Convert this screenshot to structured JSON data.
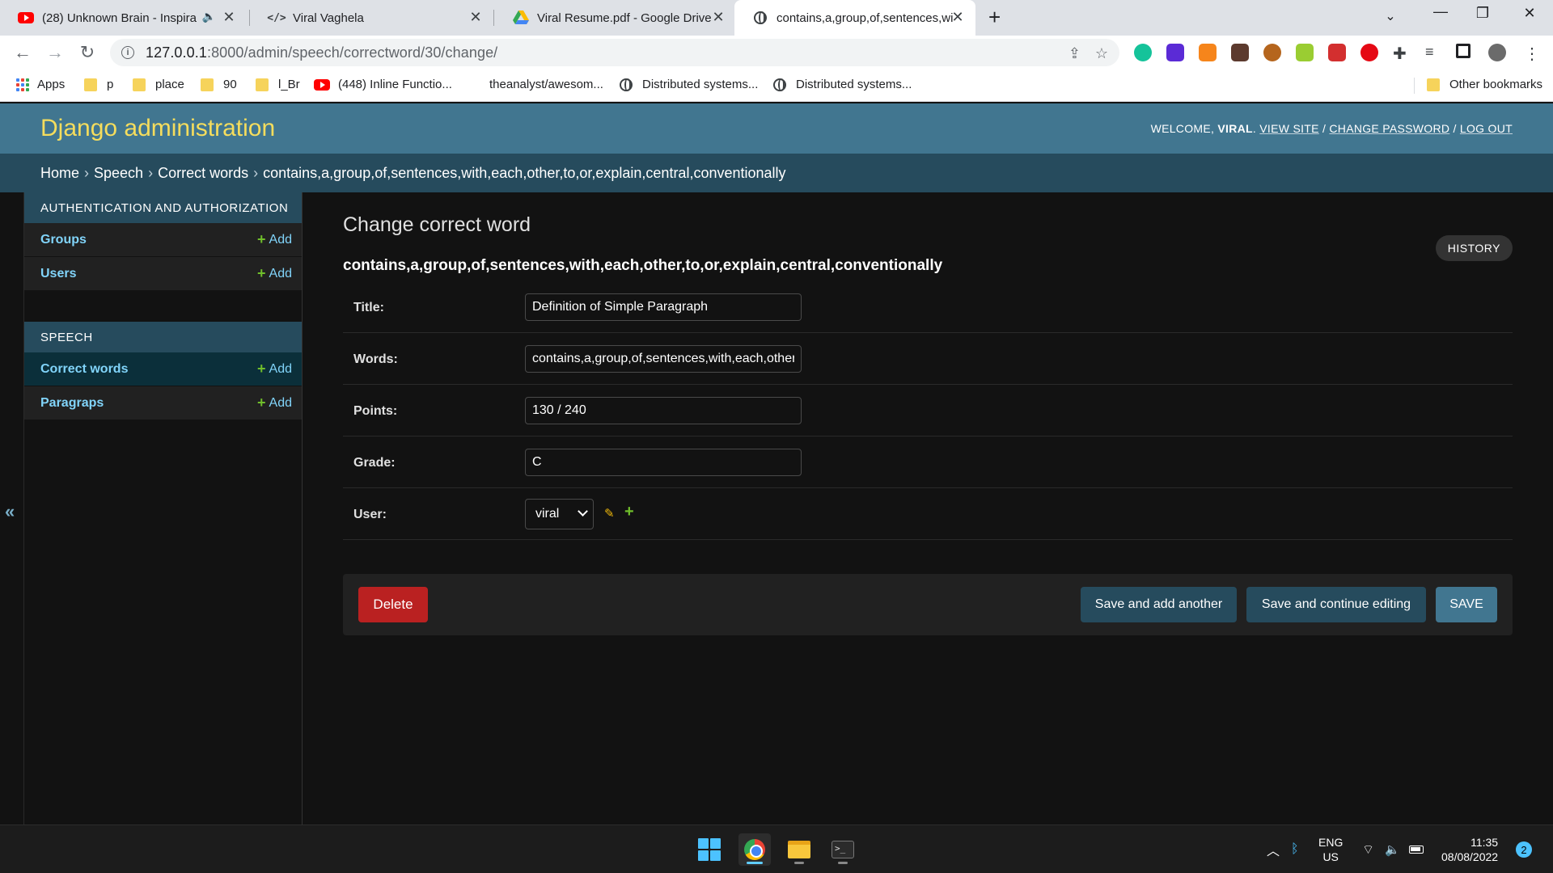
{
  "browser": {
    "tabs": [
      {
        "title": "(28) Unknown Brain - Inspira",
        "icon": "youtube-icon",
        "audio": "🔈"
      },
      {
        "title": "Viral Vaghela",
        "icon": "code-icon"
      },
      {
        "title": "Viral Resume.pdf - Google Drive",
        "icon": "google-drive-icon"
      },
      {
        "title": "contains,a,group,of,sentences,wi",
        "icon": "globe-icon",
        "active": true
      }
    ],
    "new_tab": "+",
    "url_host": "127.0.0.1",
    "url_path": ":8000/admin/speech/correctword/30/change/",
    "bookmarks": [
      {
        "label": "Apps",
        "icon": "apps-icon"
      },
      {
        "label": "p",
        "icon": "folder-icon"
      },
      {
        "label": "place",
        "icon": "folder-icon"
      },
      {
        "label": "90",
        "icon": "folder-icon"
      },
      {
        "label": "l_Br",
        "icon": "folder-icon"
      },
      {
        "label": "(448) Inline Functio...",
        "icon": "youtube-icon"
      },
      {
        "label": "theanalyst/awesom...",
        "icon": "none"
      },
      {
        "label": "Distributed systems...",
        "icon": "globe-icon"
      },
      {
        "label": "Distributed systems...",
        "icon": "globe-icon"
      }
    ],
    "other_bookmarks": "Other bookmarks"
  },
  "django": {
    "branding": "Django administration",
    "user_tools": {
      "welcome": "Welcome,",
      "username": "viral",
      "view_site": "View site",
      "change_password": "Change password",
      "log_out": "Log out"
    },
    "breadcrumbs": [
      "Home",
      "Speech",
      "Correct words",
      "contains,a,group,of,sentences,with,each,other,to,or,explain,central,conventionally"
    ],
    "sidebar": {
      "apps": [
        {
          "caption": "Authentication and Authorization",
          "models": [
            {
              "name": "Groups",
              "add": "Add"
            },
            {
              "name": "Users",
              "add": "Add"
            }
          ]
        },
        {
          "caption": "Speech",
          "models": [
            {
              "name": "Correct words",
              "add": "Add",
              "current": true
            },
            {
              "name": "Paragraps",
              "add": "Add"
            }
          ]
        }
      ],
      "collapse_toggle": "«"
    },
    "content": {
      "page_title": "Change correct word",
      "history": "History",
      "object_title": "contains,a,group,of,sentences,with,each,other,to,or,explain,central,conventionally",
      "fields": {
        "title": {
          "label": "Title:",
          "value": "Definition of Simple Paragraph"
        },
        "words": {
          "label": "Words:",
          "value": "contains,a,group,of,sentences,with,each,other,to,or,explain,central,conventionally"
        },
        "points": {
          "label": "Points:",
          "value": "130 / 240"
        },
        "grade": {
          "label": "Grade:",
          "value": "C"
        },
        "user": {
          "label": "User:",
          "value": "viral"
        }
      },
      "buttons": {
        "delete": "Delete",
        "save_add_another": "Save and add another",
        "save_continue": "Save and continue editing",
        "save": "Save"
      }
    }
  },
  "taskbar": {
    "language": "ENG",
    "region": "US",
    "time": "11:35",
    "date": "08/08/2022",
    "notifications": "2"
  },
  "colors": {
    "header": "#417690",
    "branding": "#f5dd5d",
    "breadcrumbs": "#264b5d",
    "link": "#81d4fa",
    "delete": "#ba2121",
    "add_plus": "#70bf2b"
  }
}
